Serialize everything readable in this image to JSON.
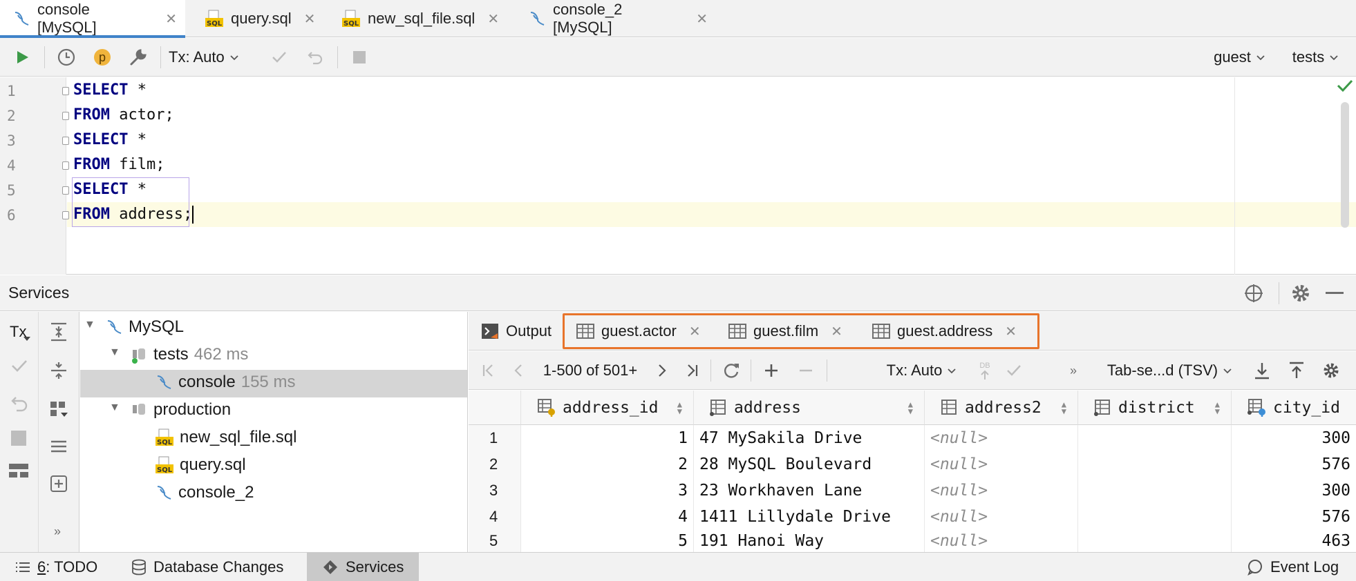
{
  "editor_tabs": [
    {
      "label": "console [MySQL]",
      "icon": "mysql-console-icon",
      "active": true
    },
    {
      "label": "query.sql",
      "icon": "sql-file-icon",
      "active": false
    },
    {
      "label": "new_sql_file.sql",
      "icon": "sql-file-icon",
      "active": false
    },
    {
      "label": "console_2 [MySQL]",
      "icon": "mysql-console-icon",
      "active": false
    }
  ],
  "toolbar": {
    "tx_label": "Tx: Auto",
    "session_badge": "p",
    "user": "guest",
    "schema": "tests"
  },
  "editor": {
    "line_numbers": [
      "1",
      "2",
      "3",
      "4",
      "5",
      "6"
    ],
    "lines": [
      {
        "kw": "SELECT",
        "rest": " *"
      },
      {
        "kw": "FROM",
        "rest": " actor;"
      },
      {
        "kw": "SELECT",
        "rest": " *"
      },
      {
        "kw": "FROM",
        "rest": " film;"
      },
      {
        "kw": "SELECT",
        "rest": " *"
      },
      {
        "kw": "FROM",
        "rest": " address;"
      }
    ]
  },
  "services": {
    "title": "Services",
    "side_tx": "Tx",
    "tree": [
      {
        "label": "MySQL",
        "time": ""
      },
      {
        "label": "tests",
        "time": "462 ms"
      },
      {
        "label": "console",
        "time": "155 ms"
      },
      {
        "label": "production",
        "time": ""
      },
      {
        "label": "new_sql_file.sql",
        "time": ""
      },
      {
        "label": "query.sql",
        "time": ""
      },
      {
        "label": "console_2",
        "time": ""
      }
    ]
  },
  "results": {
    "output_label": "Output",
    "tabs": [
      "guest.actor",
      "guest.film",
      "guest.address"
    ],
    "highlight_color": "#e8742b",
    "pagination": "1-500 of 501+",
    "tx_label": "Tx: Auto",
    "db_label": "DB",
    "format_label": "Tab-se...d (TSV)",
    "columns": [
      "address_id",
      "address",
      "address2",
      "district",
      "city_id"
    ],
    "rows": [
      {
        "n": "1",
        "address_id": "1",
        "address": "47 MySakila Drive",
        "address2": "<null>",
        "district": "",
        "city_id": "300"
      },
      {
        "n": "2",
        "address_id": "2",
        "address": "28 MySQL Boulevard",
        "address2": "<null>",
        "district": "",
        "city_id": "576"
      },
      {
        "n": "3",
        "address_id": "3",
        "address": "23 Workhaven Lane",
        "address2": "<null>",
        "district": "",
        "city_id": "300"
      },
      {
        "n": "4",
        "address_id": "4",
        "address": "1411 Lillydale Drive",
        "address2": "<null>",
        "district": "",
        "city_id": "576"
      },
      {
        "n": "5",
        "address_id": "5",
        "address": "191 Hanoi Way",
        "address2": "<null>",
        "district": "",
        "city_id": "463"
      }
    ]
  },
  "statusbar": {
    "todo_num": "6",
    "todo_label": ": TODO",
    "db_changes": "Database Changes",
    "services": "Services",
    "event_log": "Event Log"
  }
}
